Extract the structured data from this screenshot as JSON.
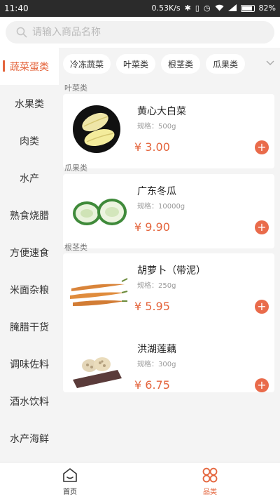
{
  "status_bar": {
    "time": "11:40",
    "network_speed": "0.53K/s",
    "battery": "82%"
  },
  "search": {
    "placeholder": "请输入商品名称",
    "value": ""
  },
  "sidebar": {
    "items": [
      {
        "label": "蔬菜蛋类",
        "active": true
      },
      {
        "label": "水果类",
        "active": false
      },
      {
        "label": "肉类",
        "active": false
      },
      {
        "label": "水产",
        "active": false
      },
      {
        "label": "熟食烧腊",
        "active": false
      },
      {
        "label": "方便速食",
        "active": false
      },
      {
        "label": "米面杂粮",
        "active": false
      },
      {
        "label": "腌腊干货",
        "active": false
      },
      {
        "label": "调味佐料",
        "active": false
      },
      {
        "label": "酒水饮料",
        "active": false
      },
      {
        "label": "水产海鲜",
        "active": false
      }
    ]
  },
  "chips": [
    "冷冻蔬菜",
    "叶菜类",
    "根茎类",
    "瓜果类"
  ],
  "sections": [
    {
      "label": "叶菜类",
      "products": [
        {
          "name": "黄心大白菜",
          "spec": "规格：500g",
          "price": "¥ 3.00",
          "image": "napa-cabbage-image"
        }
      ]
    },
    {
      "label": "瓜果类",
      "products": [
        {
          "name": "广东冬瓜",
          "spec": "规格：10000g",
          "price": "¥ 9.90",
          "image": "winter-melon-image"
        }
      ]
    },
    {
      "label": "根茎类",
      "products": [
        {
          "name": "胡萝卜（带泥）",
          "spec": "规格：250g",
          "price": "¥ 5.95",
          "image": "carrot-image"
        },
        {
          "name": "洪湖莲藕",
          "spec": "规格：300g",
          "price": "¥ 6.75",
          "image": "lotus-root-image"
        }
      ]
    }
  ],
  "bottom_nav": [
    {
      "label": "首页",
      "icon": "home-icon",
      "active": false
    },
    {
      "label": "品类",
      "icon": "category-icon",
      "active": true
    }
  ],
  "colors": {
    "accent": "#e4653d",
    "add_button": "#e96b4b",
    "status_bar": "#2b2b2b",
    "background": "#f4f4f4"
  }
}
